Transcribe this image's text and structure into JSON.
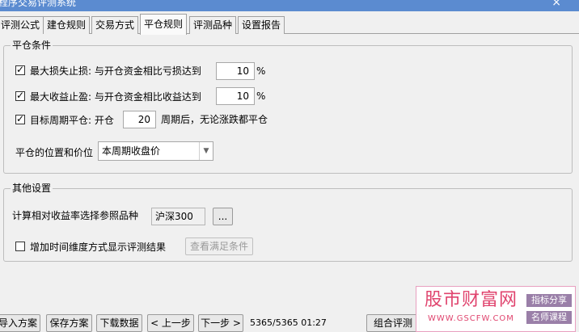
{
  "window": {
    "title": "程序交易评测系统",
    "close_glyph": "×"
  },
  "tabs": [
    {
      "label": "评测公式"
    },
    {
      "label": "建仓规则"
    },
    {
      "label": "交易方式"
    },
    {
      "label": "平仓规则"
    },
    {
      "label": "评测品种"
    },
    {
      "label": "设置报告"
    }
  ],
  "close_conditions": {
    "legend": "平仓条件",
    "stop_loss": {
      "label": "最大损失止损: 与开仓资金相比亏损达到",
      "value": "10",
      "unit": "%",
      "checked": true
    },
    "take_profit": {
      "label": "最大收益止盈: 与开仓资金相比收益达到",
      "value": "10",
      "unit": "%",
      "checked": true
    },
    "target_period": {
      "label": "目标周期平仓: 开仓",
      "value": "20",
      "suffix": "周期后，无论涨跌都平仓",
      "checked": true
    },
    "price_position": {
      "label": "平仓的位置和价位",
      "value": "本周期收盘价"
    }
  },
  "other_settings": {
    "legend": "其他设置",
    "benchmark": {
      "label": "计算相对收益率选择参照品种",
      "value": "沪深300",
      "browse_label": "..."
    },
    "time_dimension": {
      "label": "增加时间维度方式显示评测结果",
      "checked": false,
      "button_label": "查看满足条件"
    }
  },
  "bottom": {
    "import_label": "导入方案",
    "save_label": "保存方案",
    "download_label": "下载数据",
    "prev_label": "< 上一步",
    "next_label": "下一步 >",
    "status": "5365/5365 01:27",
    "combo_label": "组合评测"
  },
  "watermark": {
    "title": "股市财富网",
    "url": "WWW.GSCFW.COM",
    "tag1": "指标分享",
    "tag2": "名师课程"
  },
  "colors": {
    "titlebar": "#5b8bd0",
    "watermark_text": "#e0446e",
    "watermark_tag": "#9a7fa8"
  }
}
